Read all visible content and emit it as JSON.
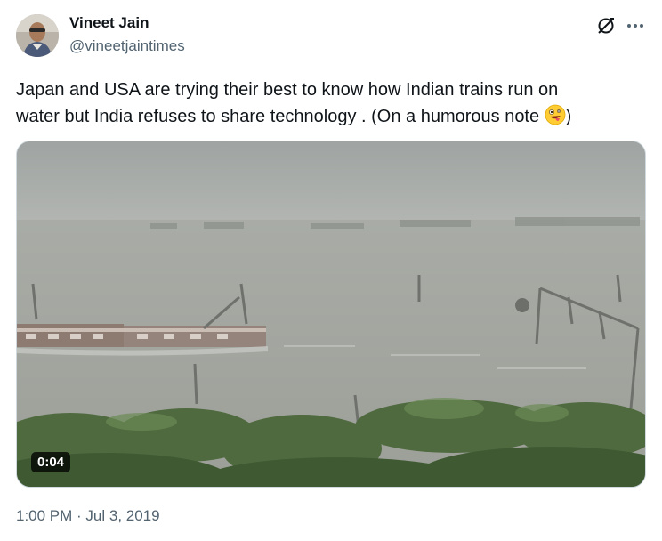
{
  "author": {
    "name": "Vineet Jain",
    "handle": "@vineetjaintimes"
  },
  "tweet": {
    "text_line_1": "Japan and USA are trying their best to know  how Indian trains run on",
    "text_line_2_main": "water but India refuses to share technology . (On a humorous note ",
    "text_line_2_end": ")",
    "emoji": "zany-face-emoji"
  },
  "media": {
    "type": "video",
    "duration": "0:04"
  },
  "meta": {
    "timestamp": "1:00 PM · Jul 3, 2019"
  },
  "icons": {
    "grok": "grok-icon",
    "more": "more-icon"
  },
  "colors": {
    "text": "#0f1419",
    "secondary": "#536471",
    "border": "#cfd9de"
  }
}
